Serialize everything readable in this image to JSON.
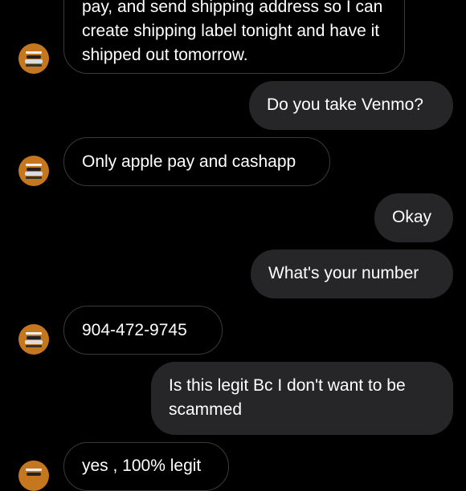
{
  "messages": [
    {
      "from": "them",
      "text": "pay, and send shipping address so I can create shipping label tonight and have it shipped out tomorrow.",
      "avatar_icon": "sneaker-icon"
    },
    {
      "from": "me",
      "text": "Do you take Venmo?"
    },
    {
      "from": "them",
      "text": "Only apple pay and cashapp",
      "avatar_icon": "sneaker-icon"
    },
    {
      "from": "me",
      "text": "Okay"
    },
    {
      "from": "me",
      "text": "What's your number"
    },
    {
      "from": "them",
      "text": "904-472-9745",
      "avatar_icon": "sneaker-icon"
    },
    {
      "from": "me",
      "text": "Is this legit Bc I don't want to be scammed"
    },
    {
      "from": "them",
      "text": "yes , 100% legit",
      "avatar_icon": "sneaker-icon"
    }
  ],
  "colors": {
    "background": "#000000",
    "outgoing_bubble": "#262628",
    "incoming_border": "#3a3a3c",
    "avatar": "#c4771f"
  }
}
